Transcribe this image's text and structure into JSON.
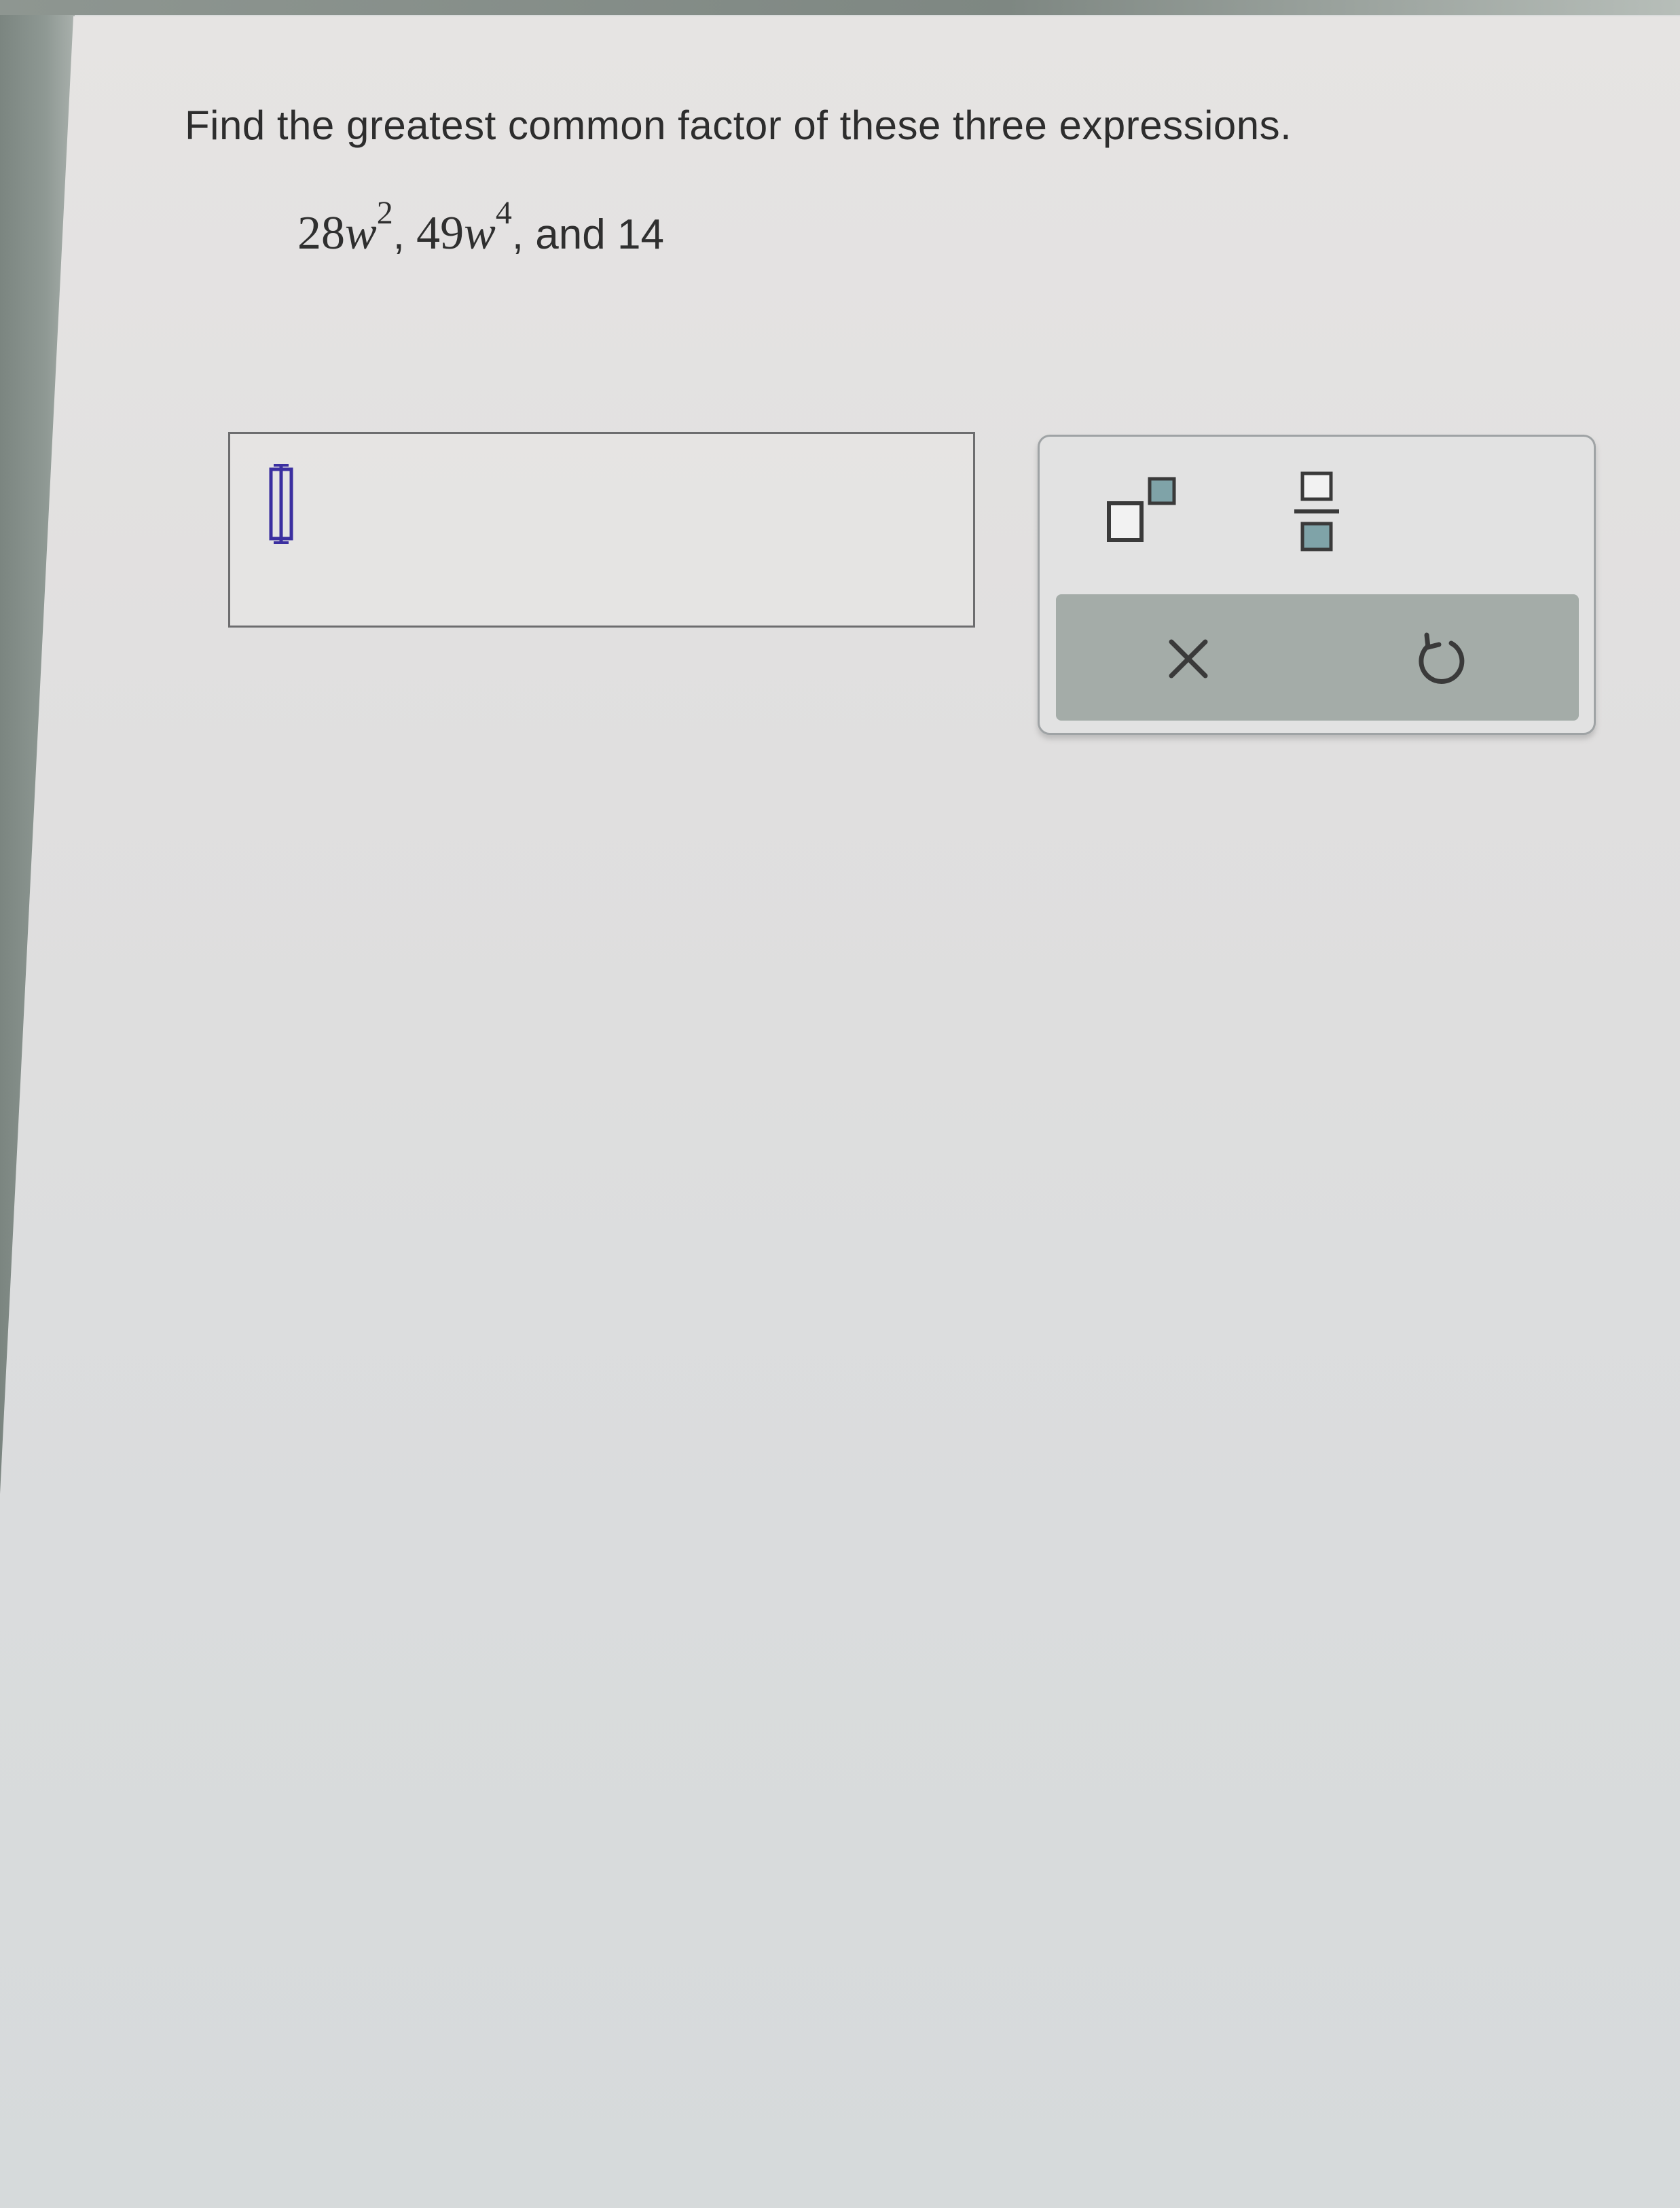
{
  "question": {
    "prompt": "Find the greatest common factor of these three expressions."
  },
  "expression": {
    "term1_coef": "28",
    "term1_var": "w",
    "term1_exp": "2",
    "sep1": ", ",
    "term2_coef": "49",
    "term2_var": "w",
    "term2_exp": "4",
    "sep2": ", and ",
    "term3": "14"
  },
  "answer": {
    "value": ""
  },
  "palette": {
    "buttons": [
      {
        "name": "exponent",
        "icon": "exponent-template-icon"
      },
      {
        "name": "fraction",
        "icon": "fraction-template-icon"
      },
      {
        "name": "clear",
        "icon": "close-icon"
      },
      {
        "name": "undo",
        "icon": "undo-icon"
      }
    ],
    "colors": {
      "accent_square": "#7fa3a8",
      "bottom_bar": "#a4aca8",
      "cursor": "#3b2fa0"
    }
  }
}
